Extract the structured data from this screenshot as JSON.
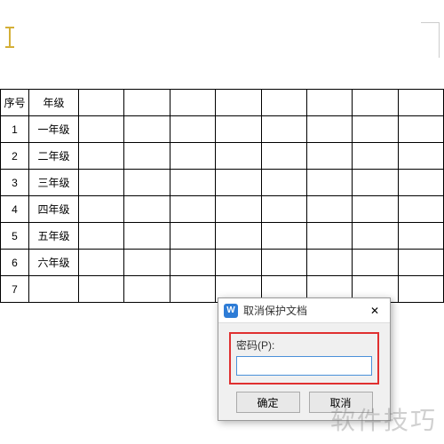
{
  "table": {
    "headers": [
      "序号",
      "年级"
    ],
    "rows": [
      {
        "idx": "1",
        "grade": "一年级"
      },
      {
        "idx": "2",
        "grade": "二年级"
      },
      {
        "idx": "3",
        "grade": "三年级"
      },
      {
        "idx": "4",
        "grade": "四年级"
      },
      {
        "idx": "5",
        "grade": "五年级"
      },
      {
        "idx": "6",
        "grade": "六年级"
      },
      {
        "idx": "7",
        "grade": ""
      }
    ],
    "extra_columns": 8
  },
  "dialog": {
    "app_icon_letter": "W",
    "title": "取消保护文档",
    "close_label": "✕",
    "password_label": "密码(P):",
    "password_value": "",
    "ok_label": "确定",
    "cancel_label": "取消"
  },
  "watermark": "软件技巧"
}
